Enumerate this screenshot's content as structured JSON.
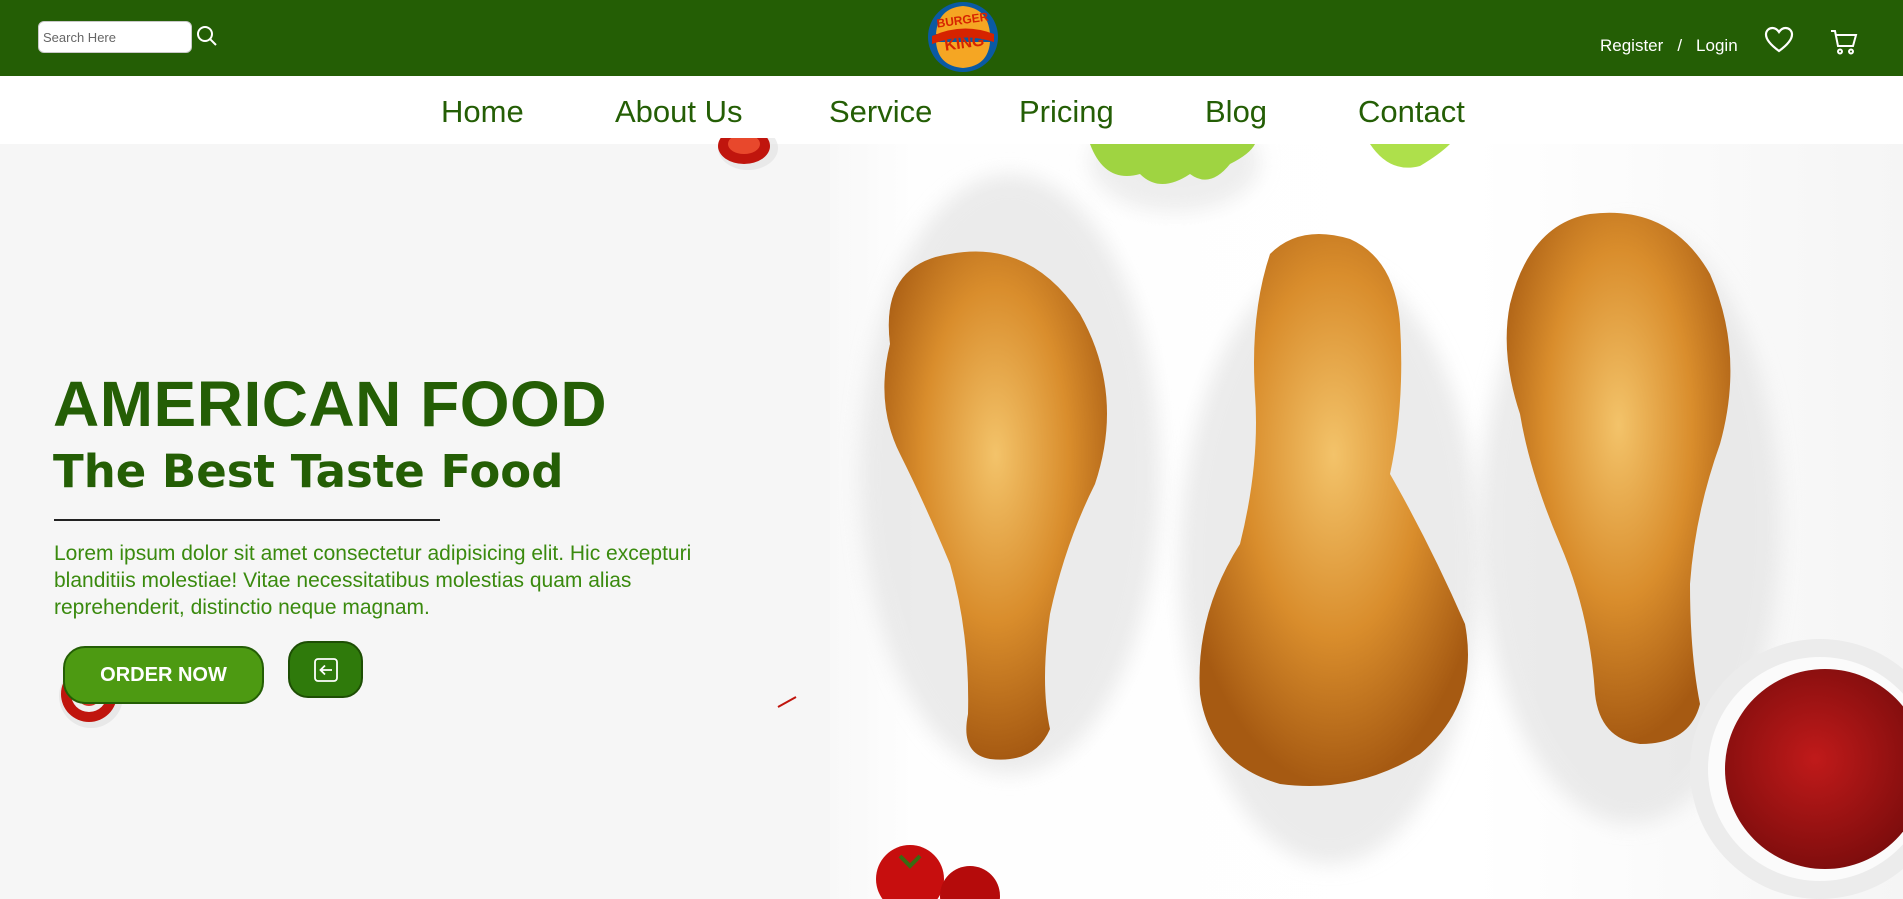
{
  "header": {
    "search": {
      "placeholder": "Search Here",
      "value": ""
    },
    "search_icon": "search-icon",
    "logo_text": [
      "BURGER",
      "KING"
    ],
    "register_label": "Register",
    "separator": "/",
    "login_label": "Login",
    "wishlist_icon": "heart-icon",
    "cart_icon": "cart-icon"
  },
  "nav": {
    "items": [
      {
        "label": "Home"
      },
      {
        "label": "About Us"
      },
      {
        "label": "Service"
      },
      {
        "label": "Pricing"
      },
      {
        "label": "Blog"
      },
      {
        "label": "Contact"
      }
    ]
  },
  "hero": {
    "title": "AMERICAN FOOD",
    "subtitle": "The Best Taste Food",
    "body": "Lorem ipsum dolor sit amet consectetur adipisicing elit. Hic excepturi blanditiis molestiae! Vitae necessitatibus molestias quam alias reprehenderit, distinctio neque magnam.",
    "order_button": "ORDER NOW",
    "back_icon": "arrow-left-square-icon"
  },
  "colors": {
    "brand_green": "#245e05",
    "accent_green": "#4d9a12",
    "text_green": "#3a8a0e"
  }
}
